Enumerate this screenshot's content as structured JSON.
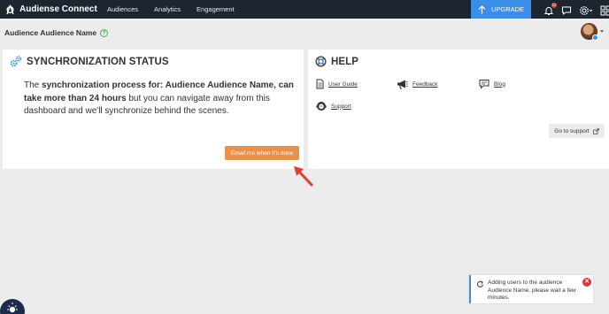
{
  "brand": {
    "name": "Audiense Connect"
  },
  "nav": {
    "items": [
      "Audiences",
      "Analytics",
      "Engagement"
    ]
  },
  "topbar": {
    "upgrade_label": "UPGRADE",
    "notification_count": "11"
  },
  "page": {
    "title": "Audience Audience Name",
    "help_symbol": "?"
  },
  "sync": {
    "title": "SYNCHRONIZATION STATUS",
    "text_1": "The ",
    "text_2": "synchronization process for: Audience Audience Name, can take more than 24 hours",
    "text_3": " but you can navigate away from this dashboard and we'll synchronize behind the scenes.",
    "email_button": "Email me when it's done"
  },
  "help": {
    "title": "HELP",
    "links": [
      "User Guide",
      "Feedback",
      "Blog",
      "Support"
    ],
    "go_to_support": "Go to support"
  },
  "toast": {
    "message": "Adding users to the audience Audience Name, please wait a few minutes."
  },
  "colors": {
    "nav_bg": "#1d2531",
    "upgrade_bg": "#3b8ee8",
    "cta_orange": "#e8914b",
    "annotation_red": "#e2402a"
  }
}
